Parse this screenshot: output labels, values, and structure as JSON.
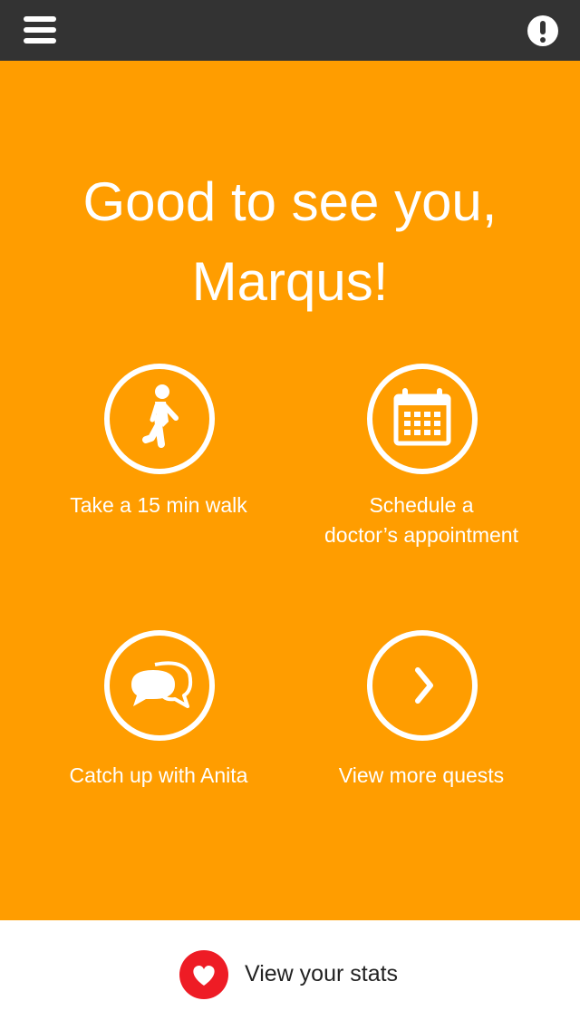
{
  "colors": {
    "header": "#333333",
    "accent": "#ff9d00",
    "heart": "#ee1c25",
    "white": "#ffffff"
  },
  "header": {
    "menu_icon": "hamburger-menu-icon",
    "alert_icon": "alert-icon"
  },
  "main": {
    "greeting_line1": "Good to see you,",
    "greeting_line2": "Marqus!",
    "quests": [
      {
        "icon": "walking-person-icon",
        "label_line1": "Take a 15 min walk",
        "label_line2": ""
      },
      {
        "icon": "calendar-icon",
        "label_line1": "Schedule a",
        "label_line2": "doctor’s appointment"
      },
      {
        "icon": "chat-bubbles-icon",
        "label_line1": "Catch up with Anita",
        "label_line2": ""
      },
      {
        "icon": "chevron-right-icon",
        "label_line1": "View more quests",
        "label_line2": ""
      }
    ]
  },
  "footer": {
    "stats_label": "View your stats",
    "stats_icon": "heart-icon"
  }
}
